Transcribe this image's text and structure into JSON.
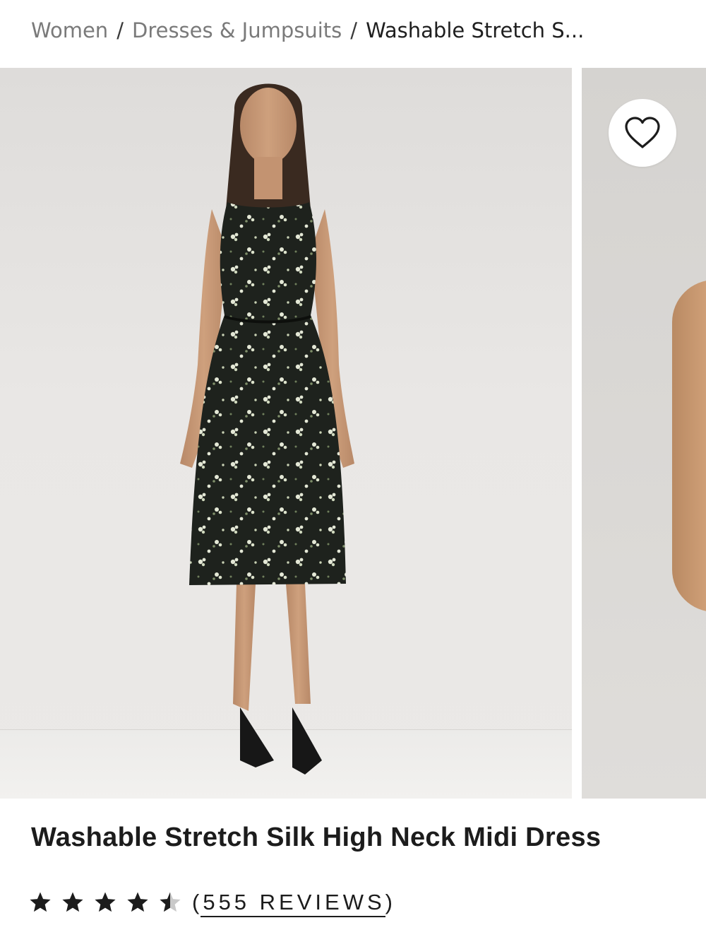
{
  "breadcrumb": {
    "items": [
      "Women",
      "Dresses & Jumpsuits"
    ],
    "separator": "/",
    "current": "Washable Stretch S..."
  },
  "gallery": {
    "main_image_alt": "",
    "wishlist_icon": "heart-outline-icon"
  },
  "product": {
    "title": "Washable Stretch Silk High Neck Midi Dress",
    "rating": 4.5,
    "rating_max": 5,
    "reviews_label": "(555 REVIEWS)"
  },
  "colors": {
    "text": "#1c1c1c",
    "muted": "#7a7a7a",
    "dress": "#1e221d",
    "floral": "#e4e8d6"
  }
}
